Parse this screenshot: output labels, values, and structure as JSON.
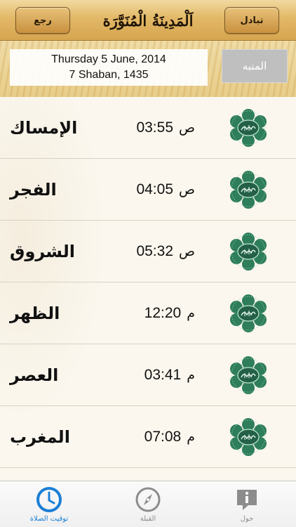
{
  "header": {
    "title": "اَلْمَدِينَةُ الْمُنَوَّرَة",
    "back_label": "رجع",
    "switch_label": "تبادل"
  },
  "date": {
    "gregorian": "Thursday 5 June, 2014",
    "hijri": "7 Shaban, 1435"
  },
  "alarm_button_label": "المنبه",
  "prayers": [
    {
      "name": "الإمساك",
      "time": "03:55",
      "period": "ص"
    },
    {
      "name": "الفجر",
      "time": "04:05",
      "period": "ص"
    },
    {
      "name": "الشروق",
      "time": "05:32",
      "period": "ص"
    },
    {
      "name": "الظهر",
      "time": "12:20",
      "period": "م"
    },
    {
      "name": "العصر",
      "time": "03:41",
      "period": "م"
    },
    {
      "name": "المغرب",
      "time": "07:08",
      "period": "م"
    }
  ],
  "medallion_icon": "allah-medallion-icon",
  "tabs": [
    {
      "label": "توقيت الصلاة",
      "icon": "clock-icon",
      "active": true
    },
    {
      "label": "القبلة",
      "icon": "compass-icon",
      "active": false
    },
    {
      "label": "حول",
      "icon": "info-icon",
      "active": false
    }
  ],
  "colors": {
    "accent": "#1a7fd6",
    "header_gold": "#d7a54f",
    "medallion_green": "#2e7d5b"
  }
}
